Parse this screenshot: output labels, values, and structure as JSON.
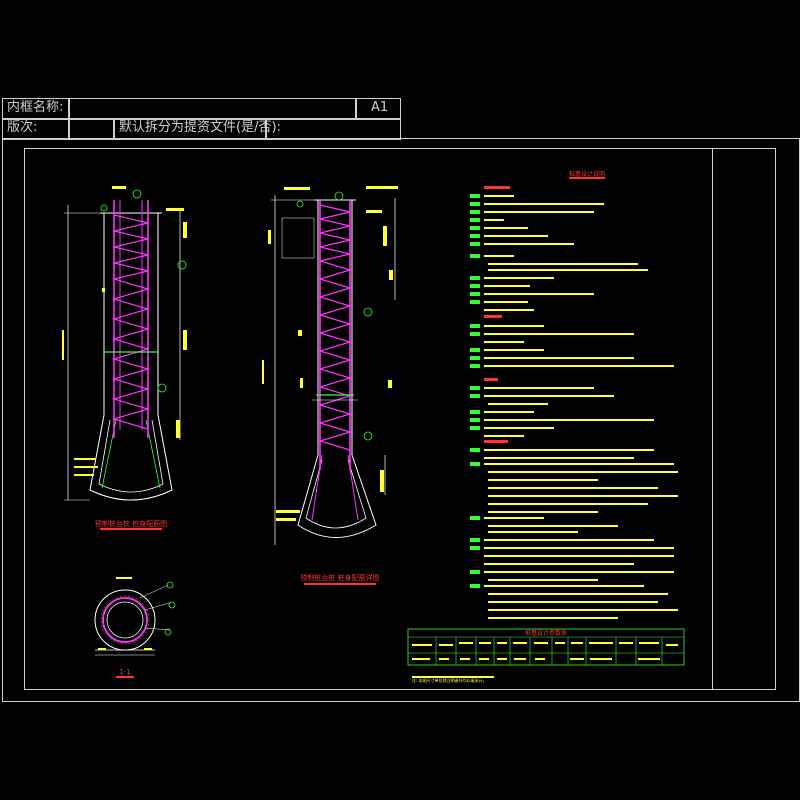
{
  "title_block": {
    "frame_name_label": "内框名称:",
    "sheet_size": "A1",
    "version_label": "版次:",
    "split_option_label": "默认拆分为提资文件(是/否):"
  },
  "drawing": {
    "elevation_1_title": "预制桩台桩 桩身配筋图",
    "elevation_2_title": "预制桩台桩 桩身配筋详图",
    "section_title": "1-1",
    "notes_title": "桩基设计说明",
    "table_title": "桩基设计参数表",
    "table_bottom_note": "注: 本图尺寸单位除注明者外均以毫米计。"
  },
  "colors": {
    "frame": "#cfcfcf",
    "rebar": "#ff33ff",
    "outline": "#ffffff",
    "annotation": "#ffff33",
    "notes_heading": "#ff3333",
    "markers": "#33ff33",
    "table_border": "#33ff33"
  }
}
